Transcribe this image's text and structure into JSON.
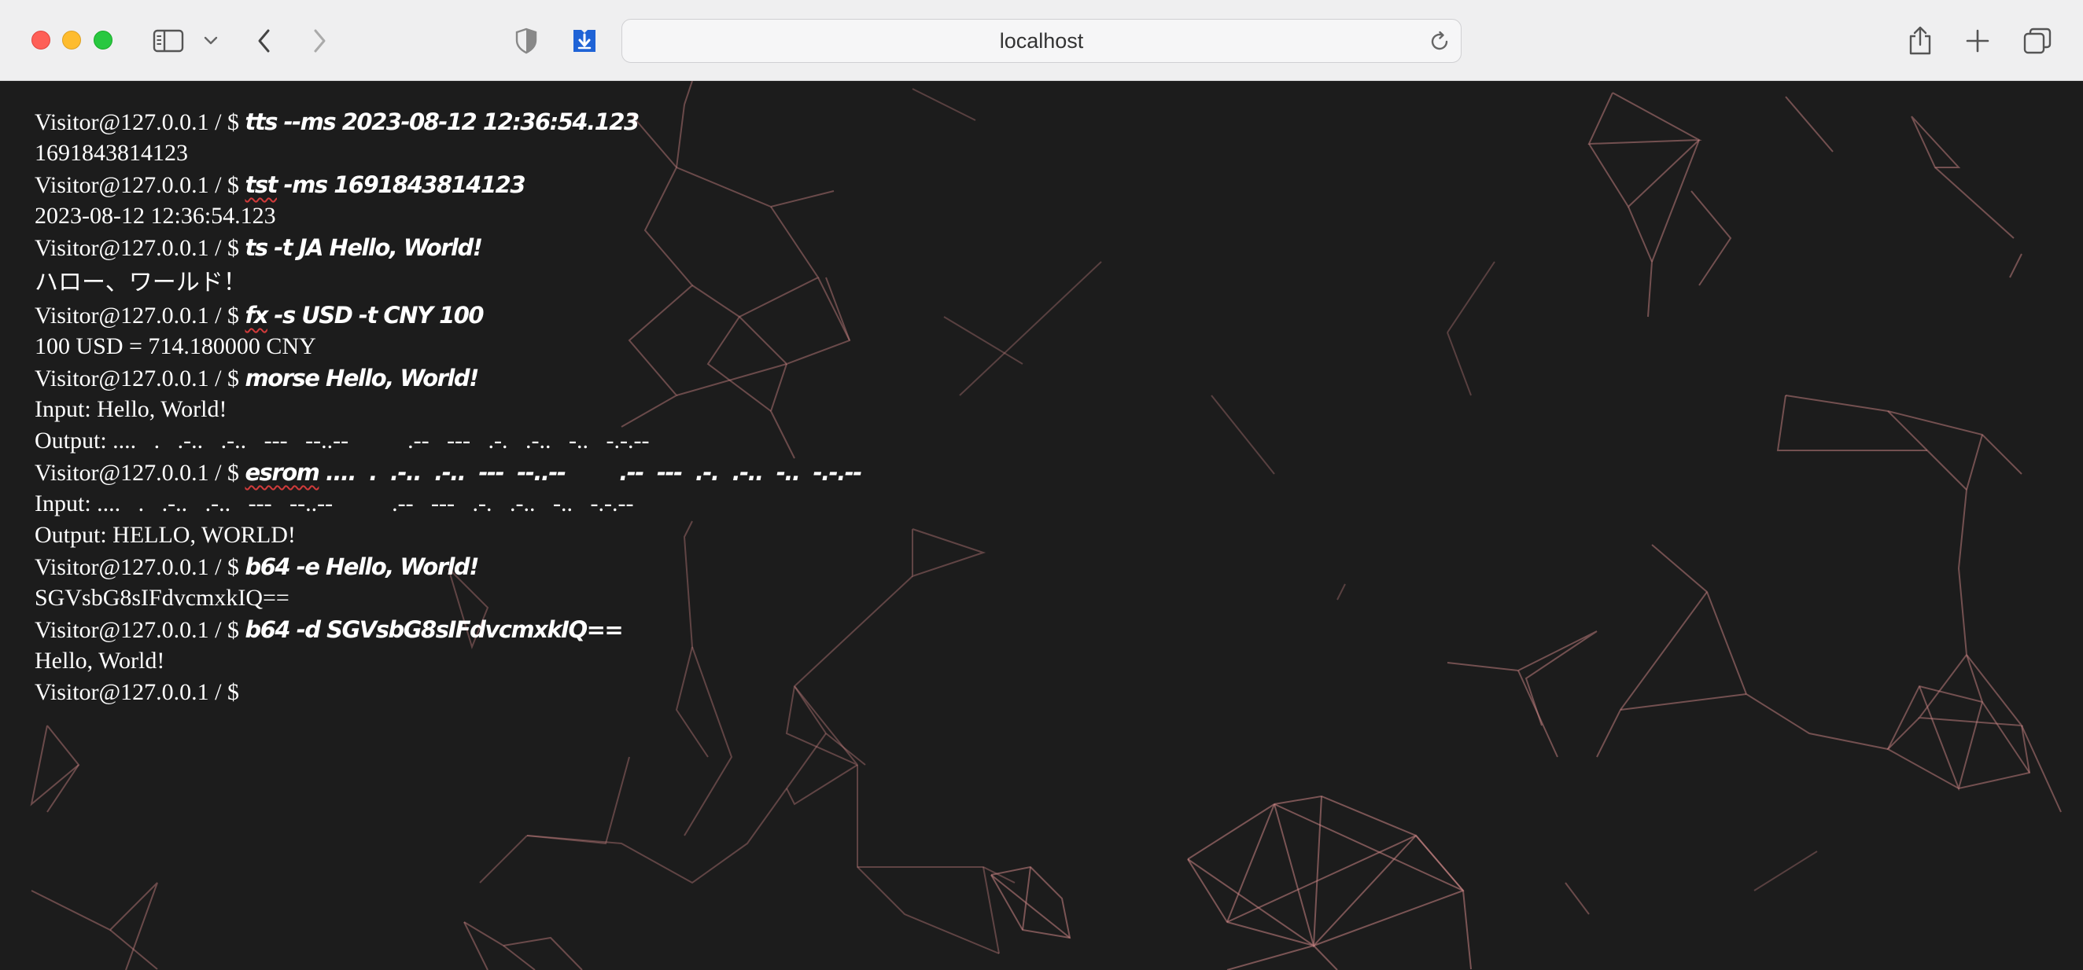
{
  "browser": {
    "url": "localhost"
  },
  "terminal": {
    "lines": [
      {
        "kind": "command",
        "prompt": "Visitor@127.0.0.1 / $",
        "text": "tts --ms 2023-08-12 12:36:54.123"
      },
      {
        "kind": "output",
        "text": "1691843814123"
      },
      {
        "kind": "command",
        "prompt": "Visitor@127.0.0.1 / $",
        "cmd": "tst",
        "args": " -ms 1691843814123"
      },
      {
        "kind": "output",
        "text": "2023-08-12 12:36:54.123"
      },
      {
        "kind": "command",
        "prompt": "Visitor@127.0.0.1 / $",
        "text": "ts -t JA Hello, World!"
      },
      {
        "kind": "output",
        "text": "ハロー、ワールド！"
      },
      {
        "kind": "command",
        "prompt": "Visitor@127.0.0.1 / $",
        "cmd": "fx",
        "args": " -s USD -t CNY 100"
      },
      {
        "kind": "output",
        "text": "100 USD = 714.180000 CNY"
      },
      {
        "kind": "command",
        "prompt": "Visitor@127.0.0.1 / $",
        "text": "morse Hello, World!"
      },
      {
        "kind": "output",
        "text": "Input: Hello, World!"
      },
      {
        "kind": "output",
        "text": "Output: ....   .   .-..   .-..   ---   --..--          .--   ---   .-.   .-..   -..   -.-.--"
      },
      {
        "kind": "command",
        "prompt": "Visitor@127.0.0.1 / $",
        "cmd": "esrom",
        "args": " ....  .  .-..  .-..  ---  --..--        .--  ---  .-.  .-..  -..  -.-.--"
      },
      {
        "kind": "output",
        "text": "Input: ....   .   .-..   .-..   ---   --..--          .--   ---   .-.   .-..   -..   -.-.--"
      },
      {
        "kind": "output",
        "text": "Output: HELLO, WORLD!"
      },
      {
        "kind": "command",
        "prompt": "Visitor@127.0.0.1 / $",
        "text": "b64 -e Hello, World!"
      },
      {
        "kind": "output",
        "text": "SGVsbG8sIFdvcmxkIQ=="
      },
      {
        "kind": "command",
        "prompt": "Visitor@127.0.0.1 / $",
        "text": "b64 -d SGVsbG8sIFdvcmxkIQ=="
      },
      {
        "kind": "output",
        "text": "Hello, World!"
      },
      {
        "kind": "prompt",
        "prompt": "Visitor@127.0.0.1 / $"
      }
    ]
  },
  "colors": {
    "background": "#1c1c1c",
    "text": "#ffffff",
    "network_lines": "#c98383",
    "spellcheck": "#d23b3b"
  },
  "icons": {
    "close": "traffic-light-close",
    "minimize": "traffic-light-minimize",
    "zoom": "traffic-light-zoom",
    "sidebar": "sidebar-icon",
    "back": "chevron-left-icon",
    "forward": "chevron-right-icon",
    "privacy": "shield-icon",
    "extension": "download-extension-icon",
    "reload": "reload-icon",
    "share": "share-icon",
    "new_tab": "plus-icon",
    "tabs": "tab-overview-icon"
  }
}
